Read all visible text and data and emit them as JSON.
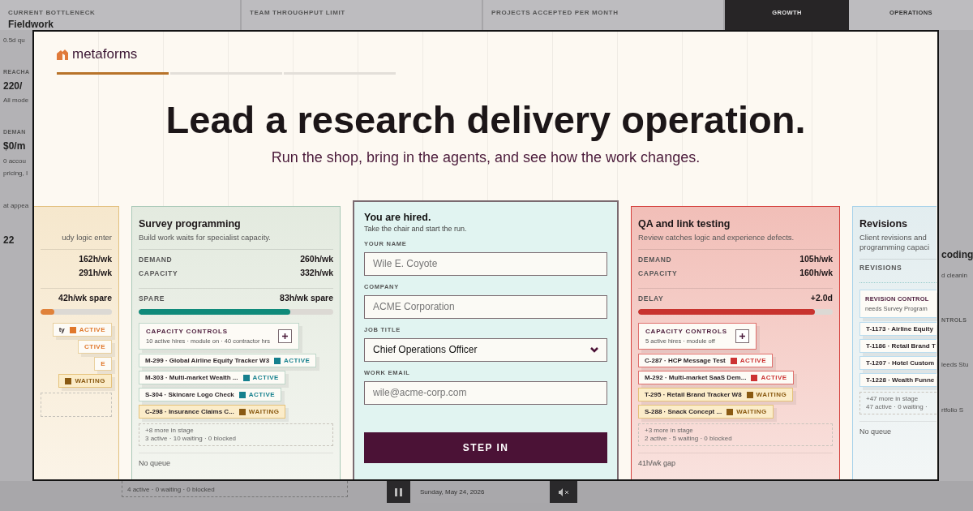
{
  "background": {
    "stats": [
      {
        "label": "CURRENT BOTTLENECK",
        "value": "Fieldwork"
      },
      {
        "label": "TEAM THROUGHPUT LIMIT"
      },
      {
        "label": "PROJECTS ACCEPTED PER MONTH"
      }
    ],
    "tabs": [
      {
        "label": "GROWTH",
        "selected": true
      },
      {
        "label": "OPERATIONS",
        "selected": false
      }
    ],
    "left_panels": [
      {
        "texts": [
          {
            "kind": "note",
            "text": "0.5d qu"
          }
        ]
      },
      {
        "texts": [
          {
            "kind": "label",
            "text": "REACHA"
          },
          {
            "kind": "value",
            "text": "220/"
          },
          {
            "kind": "note",
            "text": "All mode"
          }
        ]
      },
      {
        "texts": [
          {
            "kind": "label",
            "text": "DEMAN"
          },
          {
            "kind": "value",
            "text": "$0/m"
          },
          {
            "kind": "note",
            "text": "0 accou"
          },
          {
            "kind": "note",
            "text": "pricing, I"
          }
        ]
      },
      {
        "texts": [
          {
            "kind": "note",
            "text": "at appea"
          }
        ]
      },
      {
        "texts": [
          {
            "kind": "value",
            "text": "22"
          }
        ]
      }
    ],
    "right_panels": [
      {
        "texts": [
          {
            "kind": "value",
            "text": "coding"
          },
          {
            "kind": "note",
            "text": "d cleanin"
          }
        ]
      },
      {
        "texts": [
          {
            "kind": "label",
            "text": "NTROLS"
          }
        ]
      },
      {
        "texts": [
          {
            "kind": "note",
            "text": "leeds Stu"
          }
        ]
      },
      {
        "texts": [
          {
            "kind": "note",
            "text": "rtfolio S"
          }
        ]
      }
    ],
    "queue_summary": "4 active · 0 waiting · 0 blocked",
    "date": "Sunday, May 24, 2026"
  },
  "modal": {
    "brand": "metaforms",
    "steps": [
      {
        "complete": true
      },
      {
        "complete": false
      },
      {
        "complete": false
      }
    ],
    "headline": "Lead a research delivery operation.",
    "subheadline": "Run the shop, bring in the agents, and see how the work changes.",
    "cards": [
      {
        "kind": "leftedge",
        "color": "#e2c07e",
        "description": "udy logic enter",
        "metrics": [
          {
            "value": "162h/wk"
          },
          {
            "value": "291h/wk"
          }
        ],
        "gauge": {
          "value": "42h/wk spare",
          "level": 0.19,
          "color": "#e0823a"
        },
        "tickets": [
          {
            "kind": "active",
            "title": "ty",
            "status": "ACTIVE",
            "color": "#e0782c"
          },
          {
            "kind": "active",
            "status": "CTIVE",
            "color": "#e0782c",
            "swatch": false
          },
          {
            "kind": "active",
            "status": "E",
            "color": "#e0782c",
            "swatch": false
          },
          {
            "kind": "waiting",
            "status": "WAITING",
            "color": "#8a5a12"
          }
        ]
      },
      {
        "kind": "stage",
        "color": "#a9c9b8",
        "title": "Survey programming",
        "description": "Build work waits for specialist capacity.",
        "metrics": [
          {
            "label": "DEMAND",
            "value": "260h/wk"
          },
          {
            "label": "CAPACITY",
            "value": "332h/wk"
          }
        ],
        "gauge": {
          "label": "SPARE",
          "value": "83h/wk spare",
          "level": 0.78,
          "color": "#0f8a7a"
        },
        "controls": {
          "title": "CAPACITY CONTROLS",
          "detail": "10 active hires · module on · 40 contractor hrs",
          "add_button": true
        },
        "tickets": [
          {
            "kind": "active",
            "title": "M-299 · Global Airline Equity Tracker W3",
            "status": "ACTIVE",
            "color": "#16808e"
          },
          {
            "kind": "active",
            "title": "M-303 · Multi-market Wealth ...",
            "status": "ACTIVE",
            "color": "#16808e"
          },
          {
            "kind": "active",
            "title": "S-304 · Skincare Logo Check",
            "status": "ACTIVE",
            "color": "#16808e"
          },
          {
            "kind": "waiting",
            "title": "C-298 · Insurance Claims C...",
            "status": "WAITING",
            "color": "#8a5a12"
          }
        ],
        "more": {
          "title": "+8 more in stage",
          "detail": "3 active · 10 waiting · 0 blocked"
        },
        "footer": "No queue"
      },
      {
        "kind": "form",
        "title": "You are hired.",
        "description": "Take the chair and start the run.",
        "fields": [
          {
            "kind": "text",
            "label": "YOUR NAME",
            "placeholder": "Wile E. Coyote"
          },
          {
            "kind": "text",
            "label": "COMPANY",
            "placeholder": "ACME Corporation"
          },
          {
            "kind": "select",
            "label": "JOB TITLE",
            "value": "Chief Operations Officer"
          },
          {
            "kind": "text",
            "label": "WORK EMAIL",
            "placeholder": "wile@acme-corp.com"
          }
        ],
        "submit": "STEP IN"
      },
      {
        "kind": "stage",
        "color": "#d4403c",
        "title": "QA and link testing",
        "description": "Review catches logic and experience defects.",
        "metrics": [
          {
            "label": "DEMAND",
            "value": "105h/wk"
          },
          {
            "label": "CAPACITY",
            "value": "160h/wk"
          }
        ],
        "gauge": {
          "label": "DELAY",
          "value": "+2.0d",
          "level": 0.91,
          "color": "#c8332e"
        },
        "controls": {
          "title": "CAPACITY CONTROLS",
          "detail": "5 active hires · module off",
          "add_button": true
        },
        "tickets": [
          {
            "kind": "active",
            "title": "C-287 · HCP Message Test",
            "status": "ACTIVE",
            "color": "#cc3333"
          },
          {
            "kind": "active",
            "title": "M-292 · Multi-market SaaS Dem...",
            "status": "ACTIVE",
            "color": "#cc3333"
          },
          {
            "kind": "waiting",
            "title": "T-295 · Retail Brand Tracker W8",
            "status": "WAITING",
            "color": "#8a5a12"
          },
          {
            "kind": "waiting",
            "title": "S-288 · Snack Concept ...",
            "status": "WAITING",
            "color": "#8a5a12"
          }
        ],
        "more": {
          "title": "+3 more in stage",
          "detail": "2 active · 5 waiting · 0 blocked"
        },
        "footer": "41h/wk gap"
      },
      {
        "kind": "rightedge",
        "color": "#a6d2ea",
        "title": "Revisions",
        "description": "Client revisions and programming capaci",
        "gauge": {
          "label": "REVISIONS"
        },
        "controls": {
          "title": "REVISION CONTROL",
          "detail": "needs Survey Program"
        },
        "tickets": [
          {
            "kind": "active",
            "title": "T-1173 · Airline Equity"
          },
          {
            "kind": "active",
            "title": "T-1186 · Retail Brand T"
          },
          {
            "kind": "active",
            "title": "T-1207 · Hotel Custom"
          },
          {
            "kind": "active",
            "title": "T-1228 · Wealth Funne"
          }
        ],
        "more": {
          "title": "+47 more in stage",
          "detail": "47 active · 0 waiting ·"
        },
        "footer": "No queue"
      }
    ]
  }
}
